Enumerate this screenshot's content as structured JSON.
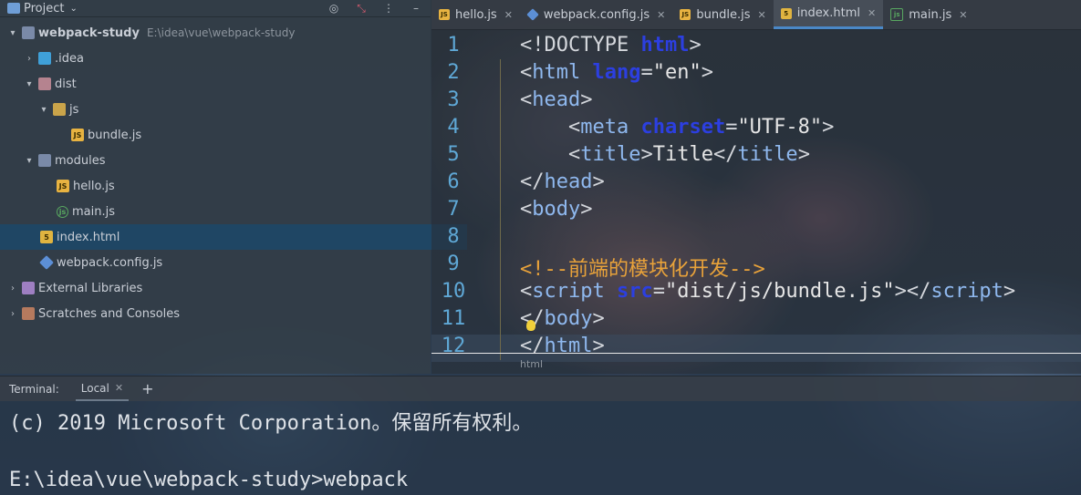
{
  "project_panel": {
    "title": "Project",
    "tree": [
      {
        "label": "webpack-study",
        "path": "E:\\idea\\vue\\webpack-study"
      },
      {
        "label": ".idea"
      },
      {
        "label": "dist"
      },
      {
        "label": "js"
      },
      {
        "label": "bundle.js"
      },
      {
        "label": "modules"
      },
      {
        "label": "hello.js"
      },
      {
        "label": "main.js"
      },
      {
        "label": "index.html"
      },
      {
        "label": "webpack.config.js"
      },
      {
        "label": "External Libraries"
      },
      {
        "label": "Scratches and Consoles"
      }
    ]
  },
  "editor": {
    "tabs": [
      {
        "label": "hello.js",
        "icon": "js-file-icon"
      },
      {
        "label": "webpack.config.js",
        "icon": "webpack-icon"
      },
      {
        "label": "bundle.js",
        "icon": "js-file-icon"
      },
      {
        "label": "index.html",
        "icon": "html-file-icon",
        "active": true
      },
      {
        "label": "main.js",
        "icon": "node-js-icon"
      }
    ],
    "line_numbers": [
      "1",
      "2",
      "3",
      "4",
      "5",
      "6",
      "7",
      "8",
      "9",
      "10",
      "11",
      "12"
    ],
    "code": {
      "l1_a": "<!DOCTYPE ",
      "l1_b": "html",
      "l1_c": ">",
      "l2_a": "<",
      "l2_b": "html ",
      "l2_c": "lang",
      "l2_d": "=",
      "l2_e": "\"en\"",
      "l2_f": ">",
      "l3_a": "<",
      "l3_b": "head",
      "l3_c": ">",
      "l4_a": "    <",
      "l4_b": "meta ",
      "l4_c": "charset",
      "l4_d": "=",
      "l4_e": "\"UTF-8\"",
      "l4_f": ">",
      "l5_a": "    <",
      "l5_b": "title",
      "l5_c": ">",
      "l5_d": "Title",
      "l5_e": "</",
      "l5_f": "title",
      "l5_g": ">",
      "l6_a": "</",
      "l6_b": "head",
      "l6_c": ">",
      "l7_a": "<",
      "l7_b": "body",
      "l7_c": ">",
      "l9": "<!--前端的模块化开发-->",
      "l10_a": "<",
      "l10_b": "script ",
      "l10_c": "src",
      "l10_d": "=",
      "l10_e": "\"dist/js/bundle.js\"",
      "l10_f": "></",
      "l10_g": "script",
      "l10_h": ">",
      "l11_a": "</",
      "l11_b": "body",
      "l11_c": ">",
      "l12_a": "</",
      "l12_b": "html",
      "l12_c": ">"
    },
    "breadcrumb": "html"
  },
  "terminal": {
    "label": "Terminal:",
    "tab": "Local",
    "lines": [
      "(c) 2019 Microsoft Corporation。保留所有权利。",
      "",
      "E:\\idea\\vue\\webpack-study>webpack"
    ]
  }
}
